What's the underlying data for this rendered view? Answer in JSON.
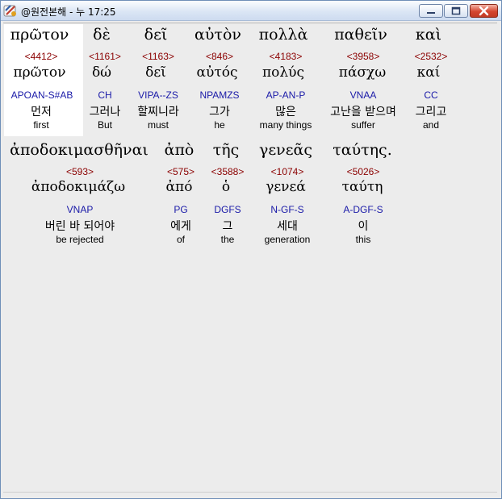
{
  "window": {
    "title": "@원전본해 - 누 17:25"
  },
  "controls": {
    "minimize": "minimize",
    "maximize": "maximize",
    "close": "close"
  },
  "lines": [
    {
      "words": [
        {
          "greek": "πρῶτον",
          "strongs": "<4412>",
          "lemma": "πρῶτον",
          "morph": "APOAN-S#AB",
          "korean": "먼저",
          "english": "first",
          "selected": true
        },
        {
          "greek": "δὲ",
          "strongs": "<1161>",
          "lemma": "δώ",
          "morph": "CH",
          "korean": "그러나",
          "english": "But"
        },
        {
          "greek": "δεῖ",
          "strongs": "<1163>",
          "lemma": "δεῖ",
          "morph": "VIPA--ZS",
          "korean": "할찌니라",
          "english": "must"
        },
        {
          "greek": "αὐτὸν",
          "strongs": "<846>",
          "lemma": "αὐτός",
          "morph": "NPAMZS",
          "korean": "그가",
          "english": "he"
        },
        {
          "greek": "πολλὰ",
          "strongs": "<4183>",
          "lemma": "πολύς",
          "morph": "AP-AN-P",
          "korean": "많은",
          "english": "many things"
        },
        {
          "greek": "παθεῖν",
          "strongs": "<3958>",
          "lemma": "πάσχω",
          "morph": "VNAA",
          "korean": "고난을 받으며",
          "english": "suffer"
        },
        {
          "greek": "καὶ",
          "strongs": "<2532>",
          "lemma": "καί",
          "morph": "CC",
          "korean": "그리고",
          "english": "and"
        }
      ]
    },
    {
      "words": [
        {
          "greek": "ἀποδοκιμασθῆναι",
          "strongs": "<593>",
          "lemma": "ἀποδοκιμάζω",
          "morph": "VNAP",
          "korean": "버린 바 되어야",
          "english": "be rejected"
        },
        {
          "greek": "ἀπὸ",
          "strongs": "<575>",
          "lemma": "ἀπό",
          "morph": "PG",
          "korean": "에게",
          "english": "of"
        },
        {
          "greek": "τῆς",
          "strongs": "<3588>",
          "lemma": "ὁ",
          "morph": "DGFS",
          "korean": "그",
          "english": "the"
        },
        {
          "greek": "γενεᾶς",
          "strongs": "<1074>",
          "lemma": "γενεά",
          "morph": "N-GF-S",
          "korean": "세대",
          "english": "generation"
        },
        {
          "greek": "ταύτης.",
          "strongs": "<5026>",
          "lemma": "ταύτη",
          "morph": "A-DGF-S",
          "korean": "이",
          "english": "this"
        }
      ]
    }
  ]
}
